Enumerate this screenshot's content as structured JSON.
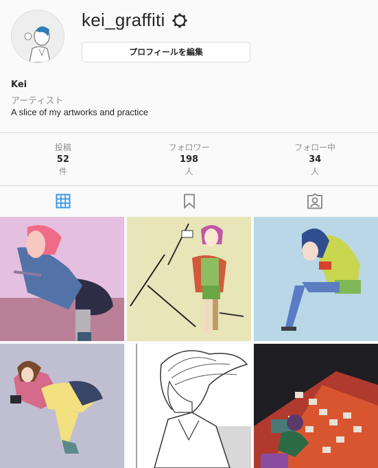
{
  "profile": {
    "username": "kei_graffiti",
    "edit_button": "プロフィールを編集",
    "name": "Kei",
    "category": "アーティスト",
    "bio": "A slice of my artworks and practice"
  },
  "stats": [
    {
      "label": "投稿",
      "value": "52",
      "unit": "件"
    },
    {
      "label": "フォロワー",
      "value": "198",
      "unit": "人"
    },
    {
      "label": "フォロー中",
      "value": "34",
      "unit": "人"
    }
  ],
  "tabs": [
    {
      "icon": "grid-icon",
      "active": true
    },
    {
      "icon": "bookmark-icon",
      "active": false
    },
    {
      "icon": "tagged-icon",
      "active": false
    }
  ],
  "colors": {
    "accent": "#3897f0",
    "border": "#dbdbdb",
    "secondary_text": "#8e8e8e"
  }
}
